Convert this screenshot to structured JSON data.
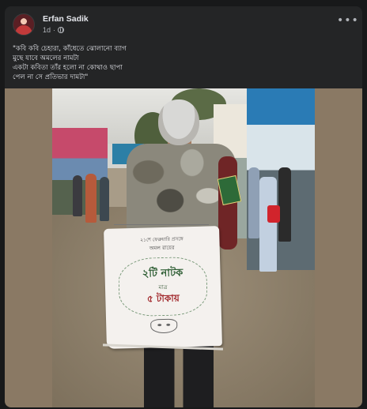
{
  "post": {
    "author": "Erfan Sadik",
    "time": "1d",
    "privacy_separator": "·",
    "more_icon": "more-horizontal-icon",
    "caption_lines": [
      "\"কবি কবি চেহারা, কাঁধেতে ঝোলানো ব্যাগ",
      "মুছে যাবে অমলের নামটা",
      "একটা কবিতা তাঁর হলো না কোথাও ছাপা",
      "পেল না সে প্রতিভার দামটা\""
    ]
  },
  "photo": {
    "placard": {
      "line1": "২১শে ফেব্রুয়ারি প্রসঙ্গে",
      "line2": "অমল রায়ের",
      "line3": "২টি নাটক",
      "line4": "মাত্র",
      "line5": "৫ টাকায়"
    }
  },
  "colors": {
    "background": "#18191a",
    "card": "#242526",
    "text_primary": "#e4e6eb",
    "text_secondary": "#b0b3b8"
  }
}
